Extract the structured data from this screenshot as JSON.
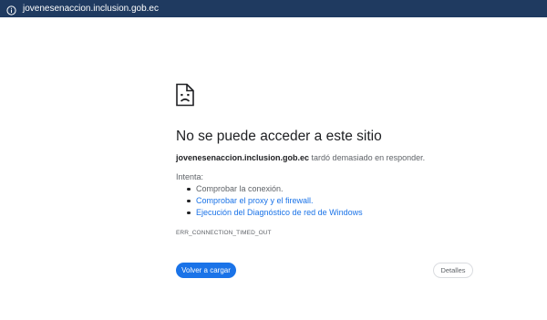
{
  "address_bar": {
    "url": "jovenesenaccion.inclusion.gob.ec",
    "icon": "info-icon"
  },
  "error": {
    "icon": "sad-page-icon",
    "title": "No se puede acceder a este sitio",
    "host": "jovenesenaccion.inclusion.gob.ec",
    "message": " tardó demasiado en responder.",
    "suggestions_label": "Intenta:",
    "suggestions": [
      {
        "text": "Comprobar la conexión.",
        "link": false
      },
      {
        "text": "Comprobar el proxy y el firewall.",
        "link": true
      },
      {
        "text": "Ejecución del Diagnóstico de red de Windows",
        "link": true
      }
    ],
    "code": "ERR_CONNECTION_TIMED_OUT"
  },
  "actions": {
    "reload_label": "Volver a cargar",
    "details_label": "Detalles"
  },
  "colors": {
    "topbar": "#1f3a60",
    "accent": "#1a73e8",
    "title_text": "#202124",
    "secondary_text": "#5f6368"
  }
}
